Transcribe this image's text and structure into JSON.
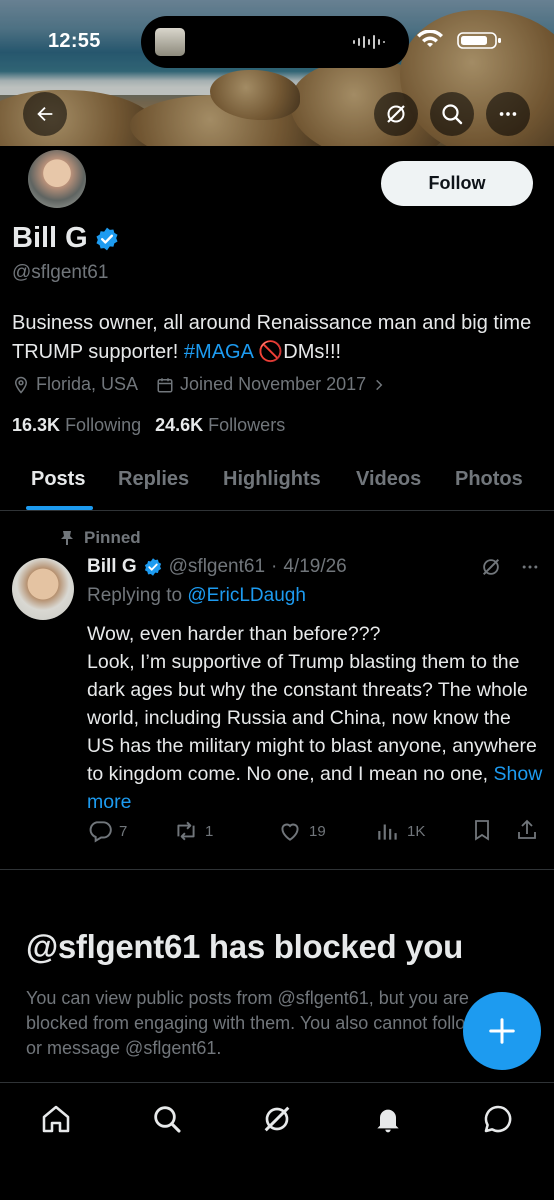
{
  "status_bar": {
    "time": "12:55"
  },
  "profile": {
    "name": "Bill G",
    "handle": "@sflgent61",
    "follow_label": "Follow",
    "bio_text": "Business owner, all around Renaissance man and big time TRUMP supporter! ",
    "bio_hashtag": "#MAGA",
    "bio_emoji": "🚫",
    "bio_end": "DMs!!!",
    "location": "Florida, USA",
    "joined": "Joined November 2017",
    "following_count": "16.3K",
    "following_label": "Following",
    "followers_count": "24.6K",
    "followers_label": "Followers"
  },
  "tabs": [
    {
      "label": "Posts",
      "active": true
    },
    {
      "label": "Replies",
      "active": false
    },
    {
      "label": "Highlights",
      "active": false
    },
    {
      "label": "Videos",
      "active": false
    },
    {
      "label": "Photos",
      "active": false
    }
  ],
  "post": {
    "pinned_label": "Pinned",
    "author_name": "Bill G",
    "author_handle": "@sflgent61",
    "separator": "·",
    "date": "4/19/26",
    "replying_prefix": "Replying to",
    "replying_to": "@EricLDaugh",
    "text": "Wow, even harder than before???\nLook, I’m supportive of Trump blasting them to the dark ages but why the constant threats? The whole world, including Russia and China, now know the US has the military might to blast anyone, anywhere to kingdom come. No one, and I mean no one,",
    "show_more": "Show more",
    "replies": "7",
    "reposts": "1",
    "likes": "19",
    "views": "1K"
  },
  "blocked": {
    "title": "@sflgent61 has blocked you",
    "text": "You can view public posts from @sflgent61, but you are blocked from engaging with them. You also cannot follow or message @sflgent61."
  },
  "colors": {
    "accent": "#1d9bf0",
    "muted": "#71767b",
    "text": "#e7e9ea",
    "background": "#000000"
  }
}
